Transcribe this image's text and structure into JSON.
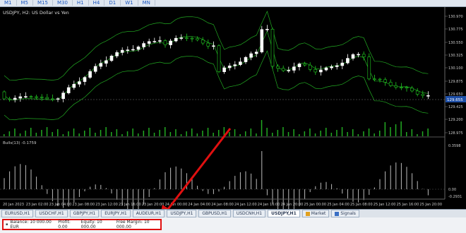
{
  "timeframes": [
    "M1",
    "M5",
    "M15",
    "M30",
    "H1",
    "H4",
    "D1",
    "W1",
    "MN"
  ],
  "chart": {
    "title": "USDJPY, H2:  US Dollar vs Yen",
    "price_labels": [
      "130.970",
      "130.775",
      "130.550",
      "130.325",
      "130.100",
      "129.875",
      "129.650",
      "129.425",
      "129.200",
      "128.975"
    ],
    "current_price": "129.655",
    "time_labels": [
      "20 Jan 2023",
      "23 Jan 02:00",
      "23 Jan 04:00",
      "23 Jan 08:00",
      "23 Jan 12:00",
      "23 Jan 16:00",
      "23 Jan 20:00",
      "24 Jan 00:00",
      "24 Jan 04:00",
      "24 Jan 08:00",
      "24 Jan 12:00",
      "24 Jan 16:00",
      "24 Jan 20:00",
      "25 Jan 00:00",
      "25 Jan 04:00",
      "25 Jan 08:00",
      "25 Jan 12:00",
      "25 Jan 16:00",
      "25 Jan 20:00"
    ],
    "indicator_title": "Bulls(13) -0.1759",
    "indicator_labels": [
      "0.3598",
      "0.00",
      "-0.2931"
    ]
  },
  "tabs": [
    {
      "label": "EURUSD,H1",
      "active": false
    },
    {
      "label": "USDCHF,H1",
      "active": false
    },
    {
      "label": "GBPJPY,H1",
      "active": false
    },
    {
      "label": "EURJPY,H1",
      "active": false
    },
    {
      "label": "AUDEUR,H1",
      "active": false
    },
    {
      "label": "USDJPY,H1",
      "active": false
    },
    {
      "label": "GBPUSD,H1",
      "active": false
    },
    {
      "label": "USDCNH,H1",
      "active": false
    },
    {
      "label": "USDJPY,H1",
      "active": true
    }
  ],
  "extra_tabs": [
    {
      "label": "Market",
      "color": "#e0a020"
    },
    {
      "label": "Signals",
      "color": "#3a6fc4"
    }
  ],
  "status": {
    "balance": "Balance: 10 000.00 EUR",
    "profit": "Profit: 0.00",
    "equity": "Equity: 10 000.00",
    "free_margin": "Free Margin: 10 000.00"
  },
  "colors": {
    "annotation": "#e01010",
    "bull": "#ffffff",
    "bear": "#22cc22",
    "bands": "#22aa22"
  }
}
